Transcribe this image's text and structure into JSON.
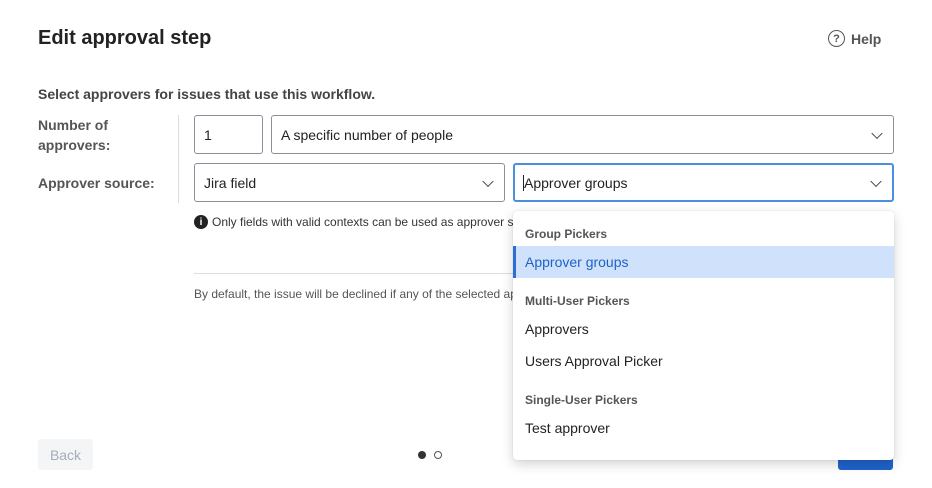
{
  "header": {
    "title": "Edit approval step",
    "help_label": "Help"
  },
  "form": {
    "subtitle": "Select approvers for issues that use this workflow.",
    "number_label_1": "Number of",
    "number_label_2": "approvers:",
    "number_value": "1",
    "number_mode": "A specific number of people",
    "source_label": "Approver source:",
    "source_type": "Jira field",
    "source_field": "Approver groups",
    "info_text": "Only fields with valid contexts can be used as approver sources.",
    "default_text": "By default, the issue will be declined if any of the selected approvers decline it."
  },
  "dropdown": {
    "groups": [
      {
        "label": "Group Pickers",
        "options": [
          "Approver groups"
        ]
      },
      {
        "label": "Multi-User Pickers",
        "options": [
          "Approvers",
          "Users Approval Picker"
        ]
      },
      {
        "label": "Single-User Pickers",
        "options": [
          "Test approver"
        ]
      }
    ],
    "selected": "Approver groups"
  },
  "footer": {
    "back_label": "Back",
    "page": 1,
    "pages": 2
  },
  "colors": {
    "accent": "#1f63cc",
    "selected_bg": "#cfe1fb"
  }
}
